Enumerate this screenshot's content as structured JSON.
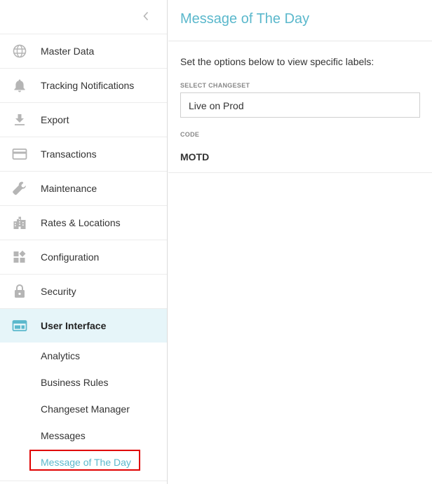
{
  "sidebar": {
    "collapse_icon": "chevron-left-icon",
    "items": [
      {
        "label": "Master Data",
        "icon": "globe-icon"
      },
      {
        "label": "Tracking Notifications",
        "icon": "bell-icon"
      },
      {
        "label": "Export",
        "icon": "download-icon"
      },
      {
        "label": "Transactions",
        "icon": "credit-card-icon"
      },
      {
        "label": "Maintenance",
        "icon": "wrench-icon"
      },
      {
        "label": "Rates & Locations",
        "icon": "city-icon"
      },
      {
        "label": "Configuration",
        "icon": "widgets-icon"
      },
      {
        "label": "Security",
        "icon": "lock-icon"
      },
      {
        "label": "User Interface",
        "icon": "web-window-icon",
        "active": true
      }
    ],
    "subitems": [
      {
        "label": "Analytics"
      },
      {
        "label": "Business Rules"
      },
      {
        "label": "Changeset Manager"
      },
      {
        "label": "Messages"
      },
      {
        "label": "Message of The Day",
        "selected": true
      }
    ]
  },
  "main": {
    "title": "Message of The Day",
    "intro": "Set the options below to view specific labels:",
    "changeset_label": "SELECT CHANGESET",
    "changeset_value": "Live on Prod",
    "code_label": "CODE",
    "code_value": "MOTD"
  },
  "colors": {
    "accent": "#5bb8cc",
    "active_bg": "#e6f5f9",
    "icon_gray": "#b5b5b5",
    "highlight_red": "#e00000"
  }
}
